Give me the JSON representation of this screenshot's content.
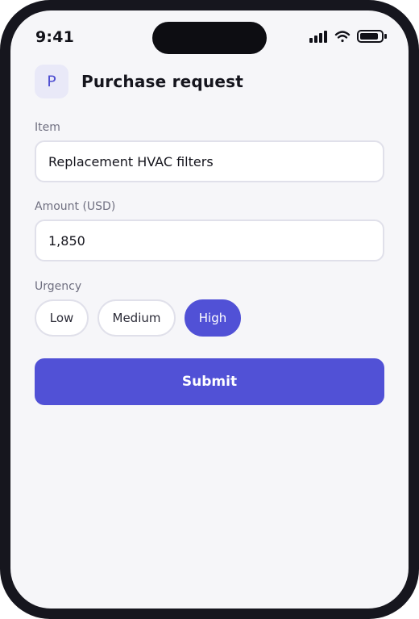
{
  "status_bar": {
    "time": "9:41",
    "icons": [
      "signal-icon",
      "wifi-icon",
      "battery-icon"
    ]
  },
  "header": {
    "icon_letter": "P",
    "title": "Purchase request"
  },
  "form": {
    "item": {
      "label": "Item",
      "value": "Replacement HVAC filters"
    },
    "amount": {
      "label": "Amount (USD)",
      "value": "1,850"
    },
    "urgency": {
      "label": "Urgency",
      "options": [
        "Low",
        "Medium",
        "High"
      ],
      "selected": "High"
    },
    "submit_label": "Submit"
  },
  "colors": {
    "accent": "#5151d6",
    "background": "#f6f6f9",
    "frame": "#16161e"
  }
}
